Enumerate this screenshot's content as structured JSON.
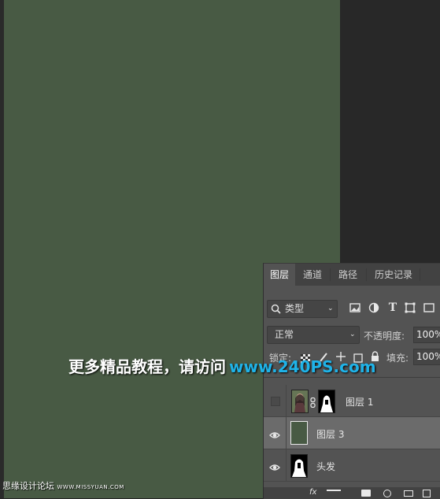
{
  "colors": {
    "canvas": "#485a44",
    "panel_bg": "#535353",
    "selected_row": "#6b6b6b",
    "watermark_url": "#1fb3e8"
  },
  "layers_panel": {
    "tabs": [
      {
        "label": "图层",
        "active": true
      },
      {
        "label": "通道",
        "active": false
      },
      {
        "label": "路径",
        "active": false
      },
      {
        "label": "历史记录",
        "active": false
      }
    ],
    "filter": {
      "selected": "类型",
      "icons": [
        "image-filter-icon",
        "adjustment-filter-icon",
        "type-filter-icon",
        "shape-filter-icon",
        "smart-object-filter-icon"
      ]
    },
    "blend_mode": "正常",
    "opacity_label": "不透明度:",
    "opacity_value": "100%",
    "lock_label": "锁定:",
    "fill_label": "填充:",
    "fill_value": "100%",
    "layers": [
      {
        "name": "图层 1",
        "visible": false,
        "has_mask": true,
        "selected": false
      },
      {
        "name": "图层 3",
        "visible": true,
        "has_mask": false,
        "selected": true
      },
      {
        "name": "头发",
        "visible": true,
        "has_mask": false,
        "selected": false
      }
    ]
  },
  "watermark": {
    "text": "更多精品教程，请访问",
    "url": "www.240PS.com"
  },
  "site_mark": {
    "name": "思缘设计论坛",
    "url": "WWW.MISSYUAN.COM"
  }
}
